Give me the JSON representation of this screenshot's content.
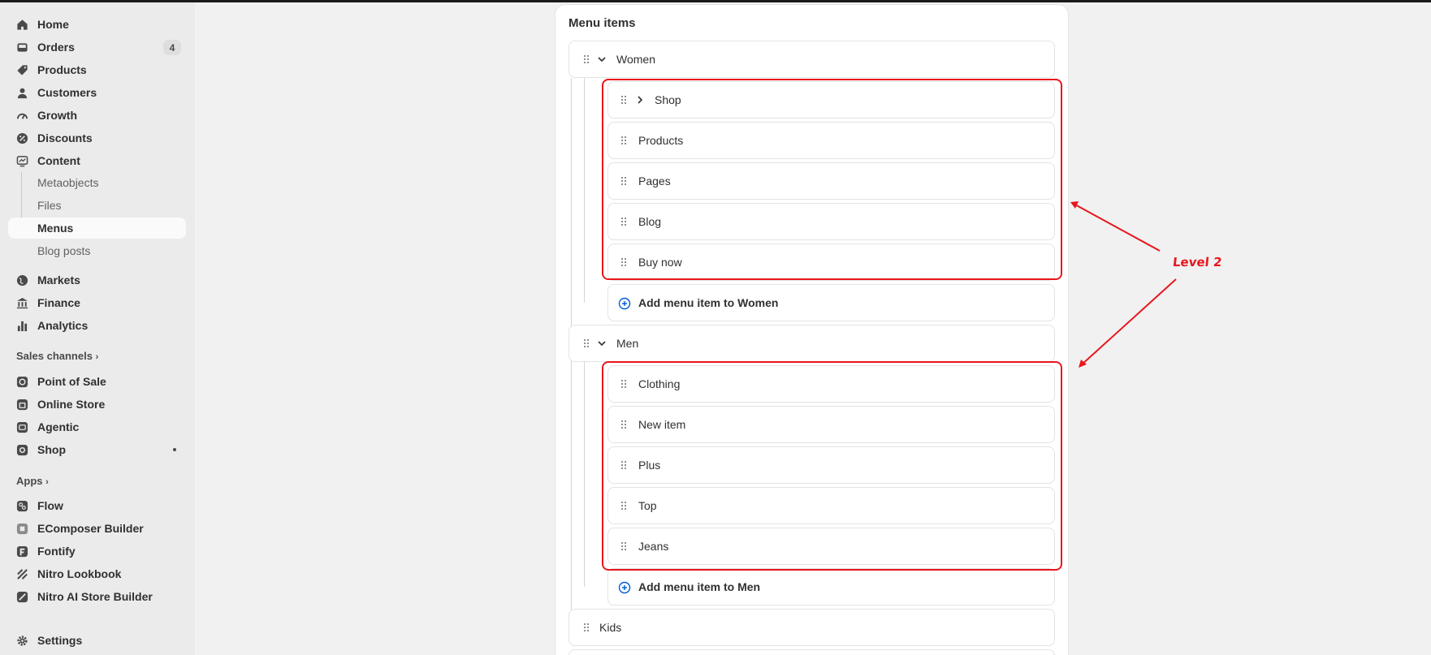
{
  "sidebar": {
    "items": [
      {
        "label": "Home",
        "icon": "home-icon"
      },
      {
        "label": "Orders",
        "icon": "orders-icon",
        "badge": "4"
      },
      {
        "label": "Products",
        "icon": "tag-icon"
      },
      {
        "label": "Customers",
        "icon": "person-icon"
      },
      {
        "label": "Growth",
        "icon": "gauge-icon"
      },
      {
        "label": "Discounts",
        "icon": "discount-icon"
      },
      {
        "label": "Content",
        "icon": "content-icon"
      }
    ],
    "content_sub": [
      "Metaobjects",
      "Files",
      "Menus",
      "Blog posts"
    ],
    "items2": [
      {
        "label": "Markets",
        "icon": "globe-icon"
      },
      {
        "label": "Finance",
        "icon": "bank-icon"
      },
      {
        "label": "Analytics",
        "icon": "bar-chart-icon"
      }
    ],
    "sales_channels_title": "Sales channels",
    "sales_channels": [
      {
        "label": "Point of Sale",
        "icon": "pos-icon"
      },
      {
        "label": "Online Store",
        "icon": "store-icon"
      },
      {
        "label": "Agentic",
        "icon": "agentic-icon"
      },
      {
        "label": "Shop",
        "icon": "shop-icon"
      }
    ],
    "apps_title": "Apps",
    "apps": [
      {
        "label": "Flow",
        "icon": "flow-icon"
      },
      {
        "label": "EComposer Builder",
        "icon": "ecomposer-icon"
      },
      {
        "label": "Fontify",
        "icon": "fontify-icon"
      },
      {
        "label": "Nitro Lookbook",
        "icon": "nitro-icon"
      },
      {
        "label": "Nitro AI Store Builder",
        "icon": "nitro-ai-icon"
      }
    ],
    "settings": {
      "label": "Settings",
      "icon": "gear-icon"
    }
  },
  "card": {
    "title": "Menu items",
    "women": {
      "label": "Women",
      "children": [
        "Shop",
        "Products",
        "Pages",
        "Blog",
        "Buy now"
      ],
      "add_label": "Add menu item to Women"
    },
    "men": {
      "label": "Men",
      "children": [
        "Clothing",
        "New item",
        "Plus",
        "Top",
        "Jeans"
      ],
      "add_label": "Add menu item to Men"
    },
    "kids": {
      "label": "Kids"
    }
  },
  "annotation": {
    "label": "Level 2",
    "color": "#e8161d"
  }
}
